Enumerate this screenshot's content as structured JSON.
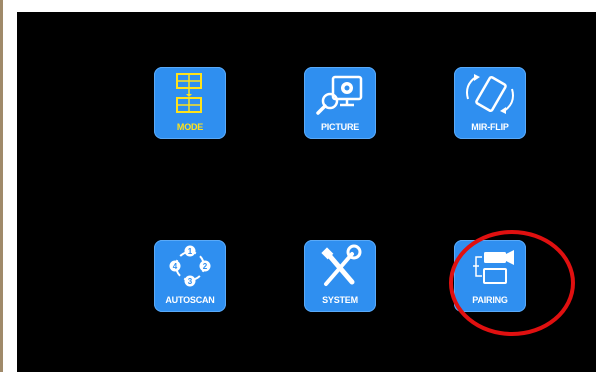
{
  "menu": {
    "items": [
      {
        "label": "MODE",
        "icon": "split-screen-icon",
        "label_color": "#ffe21a"
      },
      {
        "label": "PICTURE",
        "icon": "picture-settings-icon",
        "label_color": "#ffffff"
      },
      {
        "label": "MIR-FLIP",
        "icon": "mirror-flip-icon",
        "label_color": "#ffffff"
      },
      {
        "label": "AUTOSCAN",
        "icon": "autoscan-cycle-icon",
        "label_color": "#ffffff"
      },
      {
        "label": "SYSTEM",
        "icon": "tools-icon",
        "label_color": "#ffffff"
      },
      {
        "label": "PAIRING",
        "icon": "camera-pairing-icon",
        "label_color": "#ffffff"
      }
    ]
  },
  "colors": {
    "screen_bg": "#000000",
    "tile_bg": "#2f8ff0",
    "highlight": "#e01010"
  }
}
